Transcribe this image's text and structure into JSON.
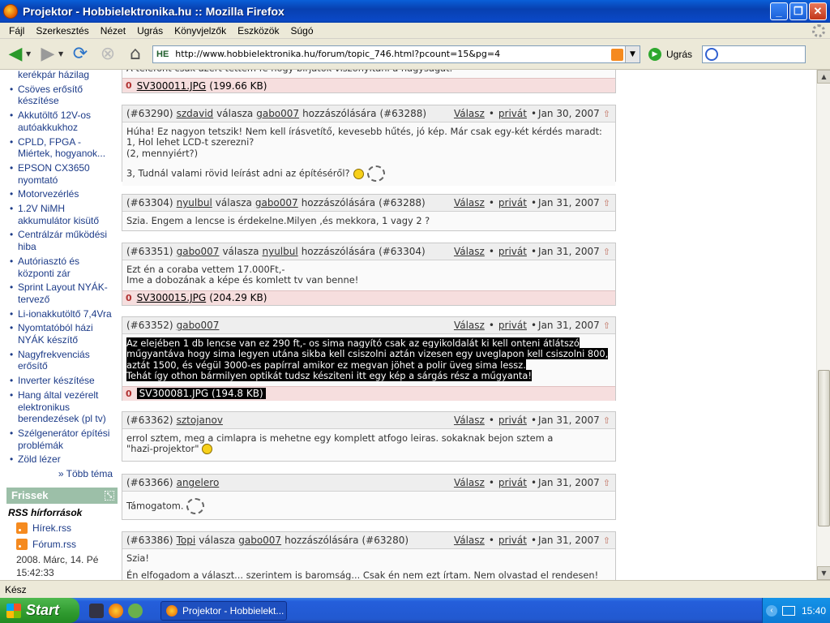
{
  "window": {
    "title": "Projektor - Hobbielektronika.hu :: Mozilla Firefox",
    "minimize": "_",
    "maximize": "❐",
    "close": "✕"
  },
  "menu": [
    "Fájl",
    "Szerkesztés",
    "Nézet",
    "Ugrás",
    "Könyvjelzők",
    "Eszközök",
    "Súgó"
  ],
  "nav": {
    "url": "http://www.hobbielektronika.hu/forum/topic_746.html?pcount=15&pg=4",
    "url_prefix": "HE",
    "go_label": "Ugrás"
  },
  "sidebar": {
    "topics": [
      "kerékpár házilag",
      "Csöves erősítő készítése",
      "Akkutöltő 12V-os autóakkukhoz",
      "CPLD, FPGA - Miértek, hogyanok...",
      "EPSON CX3650 nyomtató",
      "Motorvezérlés",
      "1.2V NiMH akkumulátor kisütő",
      "Centrálzár működési hiba",
      "Autóriasztó és központi zár",
      "Sprint Layout NYÁK-tervező",
      "Li-ionakkutöltő 7,4Vra",
      "Nyomtatóból házi NYÁK készítő",
      "Nagyfrekvenciás erősítő",
      "Inverter készítése",
      "Hang által vezérelt elektronikus berendezések (pl tv)",
      "Szélgenerátor építési problémák",
      "Zöld lézer"
    ],
    "more_topics": "» Több téma",
    "frissek": "Frissek",
    "rss_title": "RSS hírforrások",
    "rss_items": [
      "Hírek.rss",
      "Fórum.rss"
    ],
    "date_line1": "2008. Márc, 14. Pé",
    "date_line2": "15:42:33"
  },
  "posts": {
    "p0": {
      "body": "A telefont csak azért tettem fe hogy bírjátok viszonyítani a nagyságát.",
      "attach_name": "SV300011.JPG",
      "attach_size": "(199.66 KB)"
    },
    "p1": {
      "id": "(#63290)",
      "author": "szdavid",
      "reply_word": "válasza",
      "reply_to": "gabo007",
      "reply_suffix": "hozzászólására",
      "reply_id": "(#63288)",
      "valasz": "Válasz",
      "privat": "privát",
      "date": "Jan 30, 2007",
      "line1": "Húha! Ez nagyon tetszik! Nem kell írásvetítő, kevesebb hűtés, jó kép. Már csak egy-két kérdés maradt:",
      "line2": "1, Hol lehet LCD-t szerezni?",
      "line3": "(2, mennyiért?)",
      "line4": "3, Tudnál valami rövid leírást adni az építéséről?"
    },
    "p2": {
      "id": "(#63304)",
      "author": "nyulbul",
      "reply_word": "válasza",
      "reply_to": "gabo007",
      "reply_suffix": "hozzászólására",
      "reply_id": "(#63288)",
      "valasz": "Válasz",
      "privat": "privát",
      "date": "Jan 31, 2007",
      "line1": "Szia. Engem a lencse is érdekelne.Milyen ,és mekkora, 1 vagy 2 ?"
    },
    "p3": {
      "id": "(#63351)",
      "author": "gabo007",
      "reply_word": "válasza",
      "reply_to": "nyulbul",
      "reply_suffix": "hozzászólására",
      "reply_id": "(#63304)",
      "valasz": "Válasz",
      "privat": "privát",
      "date": "Jan 31, 2007",
      "line1": "Ezt én a coraba vettem 17.000Ft,-",
      "line2": "Ime a dobozának a képe és komlett tv van benne!",
      "attach_name": "SV300015.JPG",
      "attach_size": "(204.29 KB)"
    },
    "p4": {
      "id": "(#63352)",
      "author": "gabo007",
      "valasz": "Válasz",
      "privat": "privát",
      "date": "Jan 31, 2007",
      "line1": "Az elejében 1 db lencse van ez 290 ft,- os sima nagyító csak az egyikoldalát ki kell onteni átlátszó",
      "line2": "műgyantáva hogy sima legyen utána sikba kell csiszolni aztán vizesen egy uveglapon kell csiszolni 800,",
      "line3": "aztát 1500, és végül 3000-es papírral amikor ez megvan jöhet a polir üveg sima lessz.",
      "line4": "Tehát így othon bármilyen optikát tudsz késziteni itt egy kép a sárgás rész a műgyanta!",
      "attach_name": "SV300081.JPG",
      "attach_size": "(194.8 KB)"
    },
    "p5": {
      "id": "(#63362)",
      "author": "sztojanov",
      "valasz": "Válasz",
      "privat": "privát",
      "date": "Jan 31, 2007",
      "line1": "errol sztem, meg a cimlapra is mehetne egy komplett atfogo leiras. sokaknak bejon sztem a",
      "line2": "\"hazi-projektor\""
    },
    "p6": {
      "id": "(#63366)",
      "author": "angelero",
      "valasz": "Válasz",
      "privat": "privát",
      "date": "Jan 31, 2007",
      "line1": "Támogatom."
    },
    "p7": {
      "id": "(#63386)",
      "author": "Topi",
      "reply_word": "válasza",
      "reply_to": "gabo007",
      "reply_suffix": "hozzászólására",
      "reply_id": "(#63280)",
      "valasz": "Válasz",
      "privat": "privát",
      "date": "Jan 31, 2007",
      "line1": "Szia!",
      "line2": "Én elfogadom a választ... szerintem is baromság... Csak én nem ezt írtam. Nem olvastad el rendesen!"
    }
  },
  "status": "Kész",
  "taskbar": {
    "start": "Start",
    "task": "Projektor - Hobbielekt...",
    "clock": "15:40"
  }
}
